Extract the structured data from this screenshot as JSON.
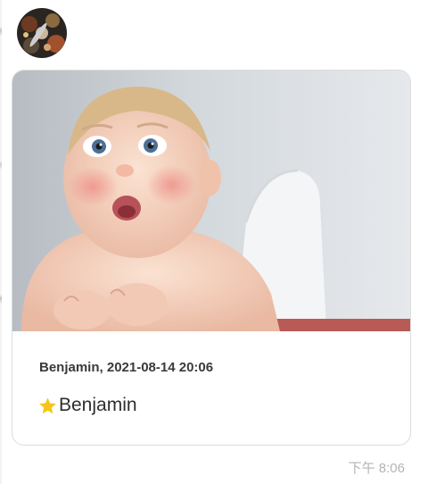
{
  "message": {
    "sender_line": "Benjamin, 2021-08-14 20:06",
    "text": "Benjamin",
    "prefix_icon": "star-icon",
    "image_subject": "surprised-baby-photo",
    "timestamp": "下午 8:06"
  },
  "avatar": {
    "icon": "avatar-image"
  },
  "colors": {
    "card_border": "#dcdcdc",
    "star": "#f5c518",
    "timestamp": "#b4b4b4",
    "meta_text": "#3a3a3a"
  }
}
